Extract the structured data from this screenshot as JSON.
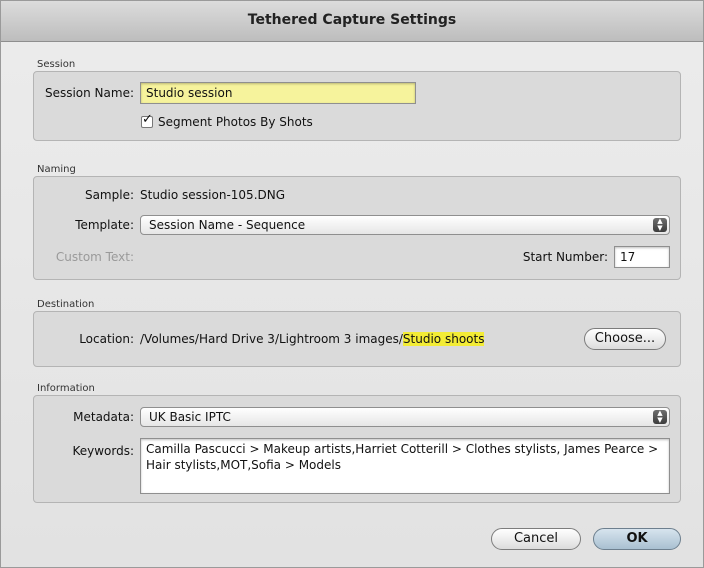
{
  "dialog": {
    "title": "Tethered Capture Settings"
  },
  "session": {
    "section_label": "Session",
    "name_label": "Session Name:",
    "name_value": "Studio session",
    "segment_label": "Segment Photos By Shots",
    "segment_checked": true
  },
  "naming": {
    "section_label": "Naming",
    "sample_label": "Sample:",
    "sample_value": "Studio session-105.DNG",
    "template_label": "Template:",
    "template_value": "Session Name - Sequence",
    "custom_text_label": "Custom Text:",
    "start_number_label": "Start Number:",
    "start_number_value": "17"
  },
  "destination": {
    "section_label": "Destination",
    "location_label": "Location:",
    "location_path": "/Volumes/Hard Drive 3/Lightroom 3 images/",
    "location_highlight": "Studio shoots",
    "choose_label": "Choose..."
  },
  "information": {
    "section_label": "Information",
    "metadata_label": "Metadata:",
    "metadata_value": "UK Basic IPTC",
    "keywords_label": "Keywords:",
    "keywords_value": "Camilla Pascucci > Makeup artists,Harriet Cotterill > Clothes stylists, James Pearce > Hair stylists,MOT,Sofia > Models"
  },
  "buttons": {
    "cancel": "Cancel",
    "ok": "OK"
  },
  "colors": {
    "highlight": "#f3ec36",
    "field_highlight": "#f6f39c"
  }
}
